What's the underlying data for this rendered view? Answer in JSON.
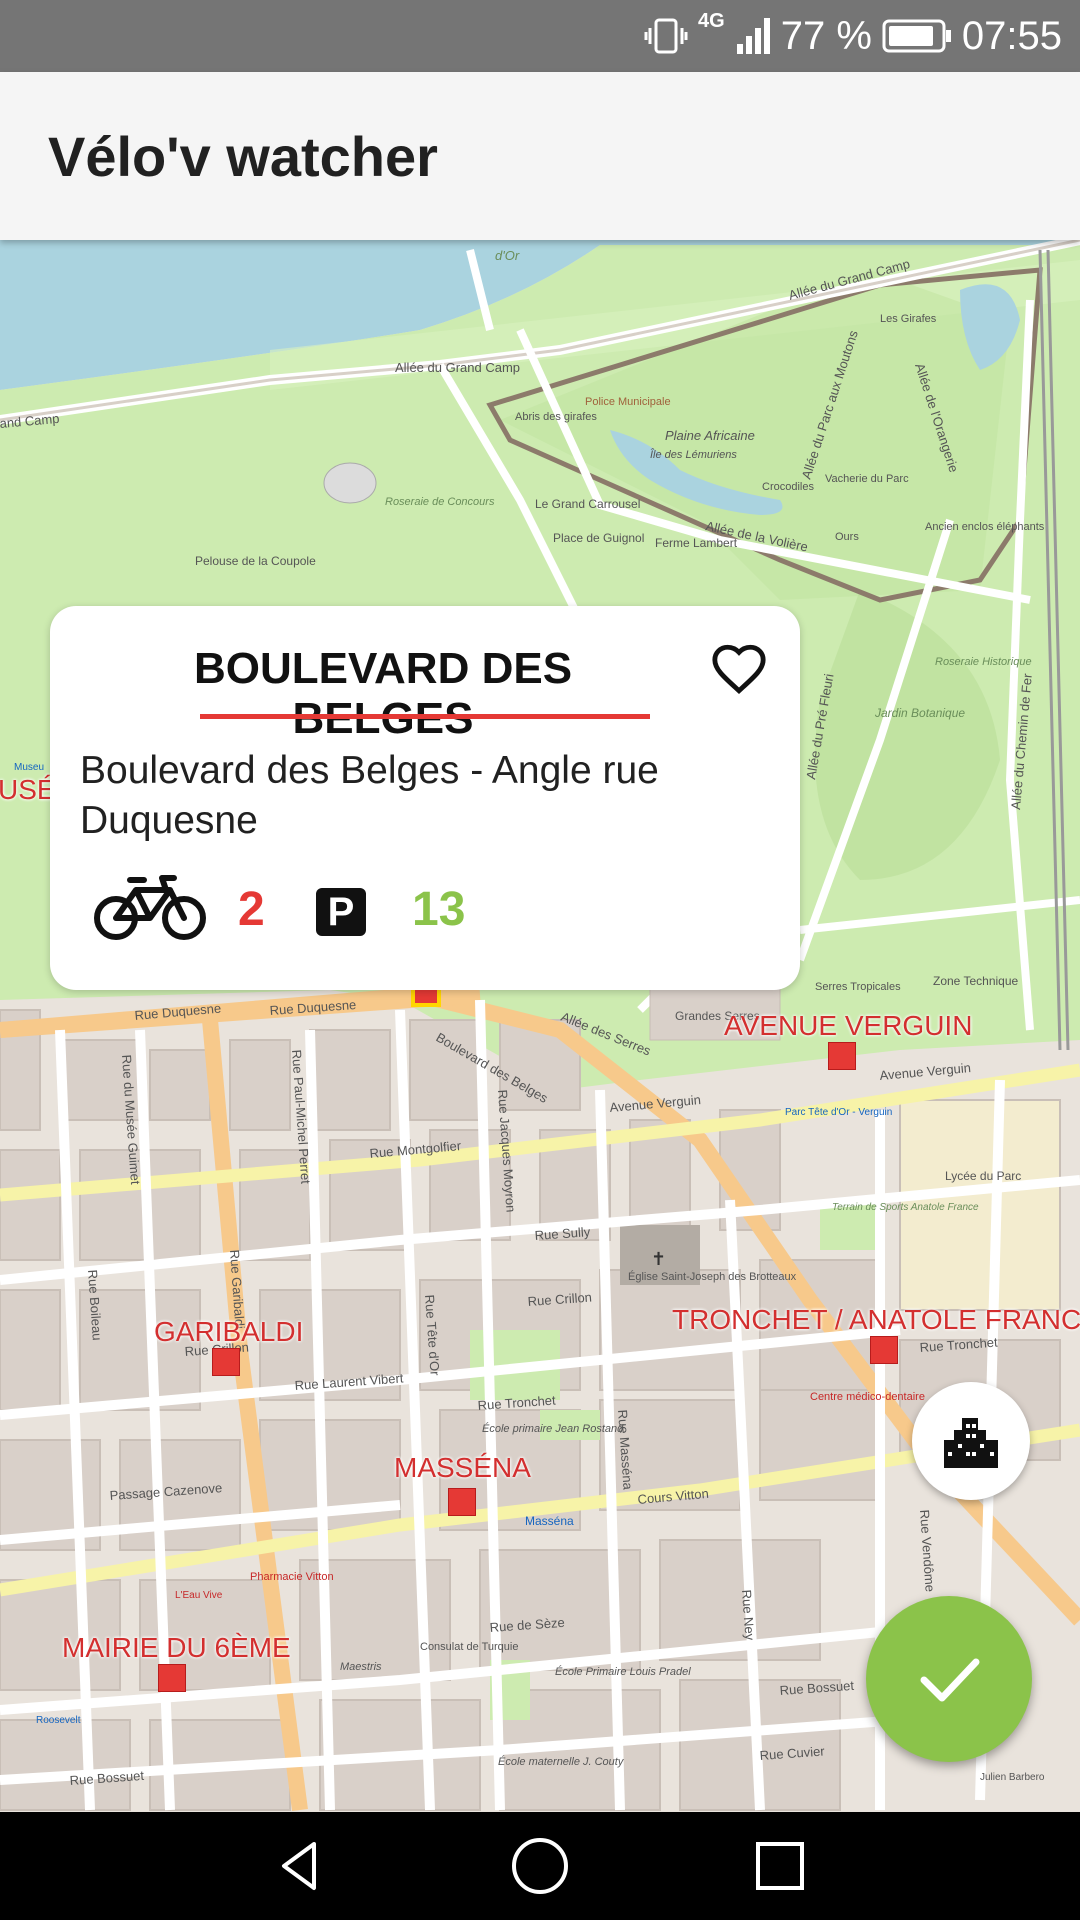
{
  "status_bar": {
    "network": "4G",
    "battery_text": "77 %",
    "time": "07:55"
  },
  "app_bar": {
    "title": "Vélo'v watcher"
  },
  "map": {
    "stations": [
      {
        "name": "AVENUE VERGUIN"
      },
      {
        "name": "GARIBALDI"
      },
      {
        "name": "TRONCHET / ANATOLE FRANC"
      },
      {
        "name": "MASSÉNA"
      },
      {
        "name": "MAIRIE DU 6ÈME"
      },
      {
        "name": "USÉ"
      }
    ],
    "labels": {
      "allee_grand_camp_1": "Allée du Grand Camp",
      "allee_grand_camp_2": "Allée du Grand Camp",
      "and_camp": "and Camp",
      "dor": "d'Or",
      "abris_girafes": "Abris des girafes",
      "police": "Police Municipale",
      "plaine_africaine": "Plaine Africaine",
      "ile_lemuriens": "Île des Lémuriens",
      "crocodiles": "Crocodiles",
      "les_girafes": "Les Girafes",
      "roseraie_concours": "Roseraie de Concours",
      "pelouse_coupole": "Pelouse de la Coupole",
      "grand_carrousel": "Le Grand Carrousel",
      "place_guignol": "Place de Guignol",
      "ferme_lambert": "Ferme Lambert",
      "vacherie": "Vacherie du Parc",
      "ours": "Ours",
      "enclos_elephants": "Ancien enclos éléphants",
      "allee_voliere": "Allée de la Volière",
      "allee_parc_moutons": "Allée du Parc aux Moutons",
      "allee_orangerie": "Allée de l'Orangerie",
      "roseraie_historique": "Roseraie Historique",
      "jardin_botanique": "Jardin Botanique",
      "allee_chemin_fer": "Allée du Chemin de Fer",
      "allee_pre_fleuri": "Allée du Pré Fleuri",
      "zone_technique": "Zone Technique",
      "serres_tropicales": "Serres Tropicales",
      "grandes_serres": "Grandes Serres",
      "allee_serres": "Allée des Serres",
      "rue_duquesne_1": "Rue Duquesne",
      "rue_duquesne_2": "Rue Duquesne",
      "bd_belges": "Boulevard des Belges",
      "avenue_verguin_1": "Avenue Verguin",
      "avenue_verguin_2": "Avenue Verguin",
      "rue_montgolfier": "Rue Montgolfier",
      "rue_sully": "Rue Sully",
      "rue_crillon": "Rue Crillon",
      "rue_tronchet": "Rue Tronchet",
      "rue_tronchet_2": "Rue Tronchet",
      "rue_laurent_vibert": "Rue Laurent Vibert",
      "passage_cazenove": "Passage Cazenove",
      "cours_vitton": "Cours Vitton",
      "rue_de_seze": "Rue de Sèze",
      "rue_bossuet": "Rue Bossuet",
      "rue_bossuet_2": "Rue Bossuet",
      "rue_cuvier": "Rue Cuvier",
      "rue_garibaldi": "Rue Garibaldi",
      "rue_boileau": "Rue Boileau",
      "rue_musee_guimet": "Rue du Musée Guimet",
      "rue_paul_michel_perret": "Rue Paul-Michel Perret",
      "rue_jacques_moyron": "Rue Jacques Moyron",
      "rue_massena": "Rue Masséna",
      "rue_tete_dor": "Rue Tête d'Or",
      "rue_ney": "Rue Ney",
      "rue_vendome": "Rue Vendôme",
      "eglise": "Église Saint-Joseph des Brotteaux",
      "lycee_parc": "Lycée du Parc",
      "terrain_sports": "Terrain de Sports Anatole France",
      "centre_medico": "Centre médico-dentaire",
      "ecole_jean_rostand": "École primaire Jean Rostand",
      "ecole_louis_pradel": "École Primaire Louis Pradel",
      "ecole_maternelle": "École maternelle J. Couty",
      "massena_metro": "Masséna",
      "pharmacie": "Pharmacie Vitton",
      "consulat_turquie": "Consulat de Turquie",
      "maestris": "Maestris",
      "roosevelt": "Roosevelt",
      "l_eau_vive": "L'Eau Vive",
      "musee": "Museu",
      "parc_tete_dor_verguin": "Parc Tête d'Or - Verguin",
      "julien_barbero": "Julien Barbero"
    }
  },
  "station_card": {
    "name": "BOULEVARD DES BELGES",
    "address": "Boulevard des Belges - Angle rue Duquesne",
    "available_bikes": "2",
    "parking_symbol": "P",
    "available_stands": "13"
  },
  "colors": {
    "accent_red": "#e53935",
    "accent_green": "#8bc34a",
    "park_green": "#cdebb0",
    "road_orange": "#f7c98b"
  }
}
